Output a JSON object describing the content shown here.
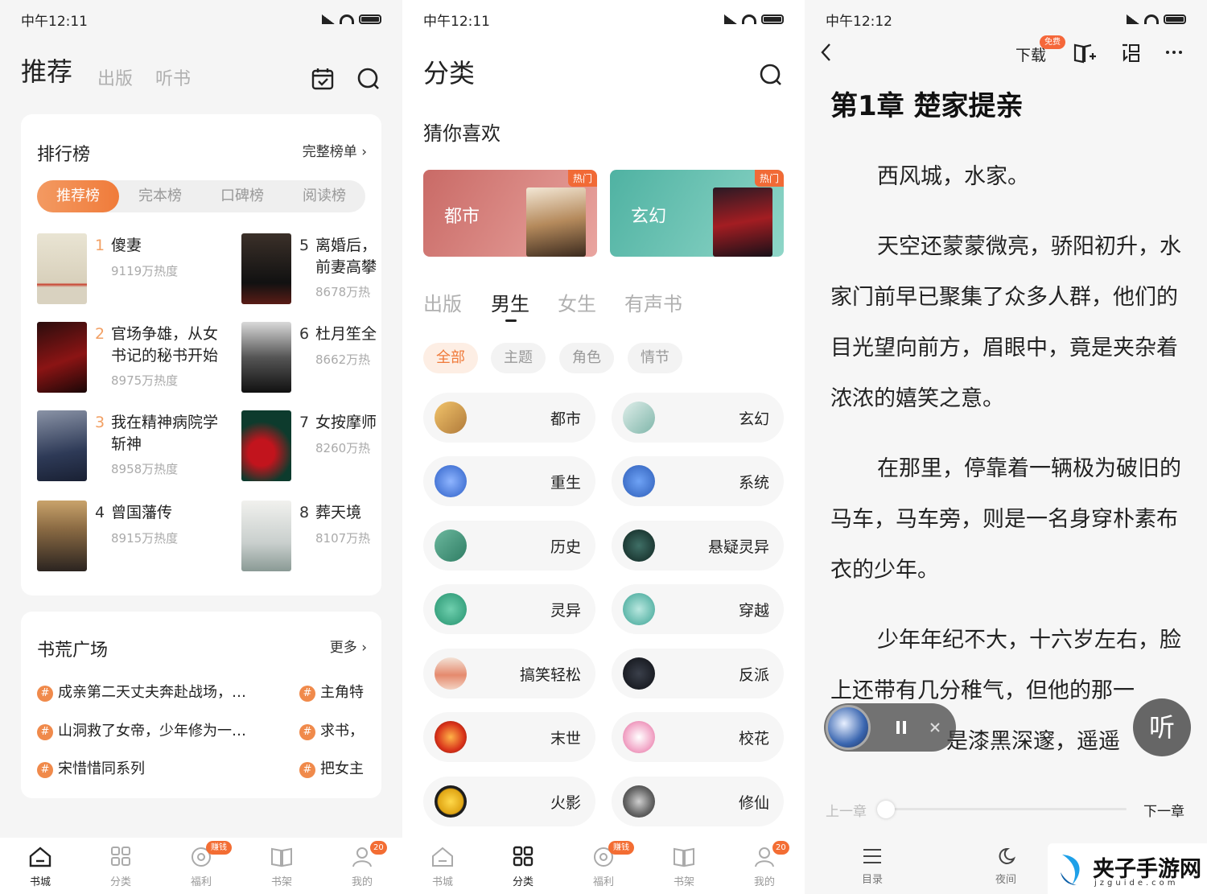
{
  "panels": {
    "bookstore": {
      "status": {
        "time": "中午12:11"
      },
      "header_tabs": [
        "推荐",
        "出版",
        "听书"
      ],
      "ranking": {
        "title": "排行榜",
        "more": "完整榜单 ›",
        "tabs": [
          "推荐榜",
          "完本榜",
          "口碑榜",
          "阅读榜"
        ],
        "items": [
          {
            "num": "1",
            "title": "傻妻",
            "heat": "9119万热度"
          },
          {
            "num": "2",
            "title": "官场争雄，从女书记的秘书开始",
            "line1": "官场争雄，从女",
            "line2": "书记的秘书开始",
            "heat": "8975万热度"
          },
          {
            "num": "3",
            "title": "我在精神病院学斩神",
            "line1": "我在精神病院学",
            "line2": "斩神",
            "heat": "8958万热度"
          },
          {
            "num": "4",
            "title": "曾国藩传",
            "heat": "8915万热度"
          },
          {
            "num": "5",
            "line1": "离婚后，",
            "line2": "前妻高攀",
            "heat": "8678万热"
          },
          {
            "num": "6",
            "title": "杜月笙全",
            "heat": "8662万热"
          },
          {
            "num": "7",
            "title": "女按摩师",
            "heat": "8260万热"
          },
          {
            "num": "8",
            "title": "葬天境",
            "heat": "8107万热"
          }
        ]
      },
      "square": {
        "title": "书荒广场",
        "more": "更多 ›",
        "topics_left": [
          "成亲第二天丈夫奔赴战场，…",
          "山洞救了女帝，少年修为一…",
          "宋惜惜同系列"
        ],
        "topics_right": [
          "主角特",
          "求书，",
          "把女主"
        ]
      },
      "nav": [
        {
          "label": "书城"
        },
        {
          "label": "分类"
        },
        {
          "label": "福利",
          "badge": "赚钱"
        },
        {
          "label": "书架"
        },
        {
          "label": "我的",
          "badge": "20"
        }
      ]
    },
    "category": {
      "status": {
        "time": "中午12:11"
      },
      "title": "分类",
      "guess": "猜你喜欢",
      "banners": [
        {
          "label": "都市",
          "tag": "热门"
        },
        {
          "label": "玄幻",
          "tag": "热门"
        }
      ],
      "gender_tabs": [
        "出版",
        "男生",
        "女生",
        "有声书"
      ],
      "chips": [
        "全部",
        "主题",
        "角色",
        "情节"
      ],
      "categories": [
        "都市",
        "玄幻",
        "重生",
        "系统",
        "历史",
        "悬疑灵异",
        "灵异",
        "穿越",
        "搞笑轻松",
        "反派",
        "末世",
        "校花",
        "火影",
        "修仙"
      ],
      "nav": [
        {
          "label": "书城"
        },
        {
          "label": "分类"
        },
        {
          "label": "福利",
          "badge": "赚钱"
        },
        {
          "label": "书架"
        },
        {
          "label": "我的",
          "badge": "20"
        }
      ]
    },
    "reader": {
      "status": {
        "time": "中午12:12"
      },
      "download": "下载",
      "download_badge": "免费",
      "chapter_title": "第1章 楚家提亲",
      "paragraphs": [
        "西风城，水家。",
        "天空还蒙蒙微亮，骄阳初升，水家门前早已聚集了众多人群，他们的目光望向前方，眉眼中，竟是夹杂着浓浓的嬉笑之意。",
        "在那里，停靠着一辆极为破旧的马车，马车旁，则是一名身穿朴素布衣的少年。",
        "少年年纪不大，十六岁左右，脸上还带有几分稚气，但他的那一",
        "是漆黑深邃，遥遥"
      ],
      "listen": "听",
      "prev_chapter": "上一章",
      "next_chapter": "下一章",
      "nav": [
        {
          "label": "目录"
        },
        {
          "label": "夜间"
        }
      ],
      "watermark": {
        "title": "夹子手游网",
        "url": "jzguide.com"
      }
    }
  }
}
